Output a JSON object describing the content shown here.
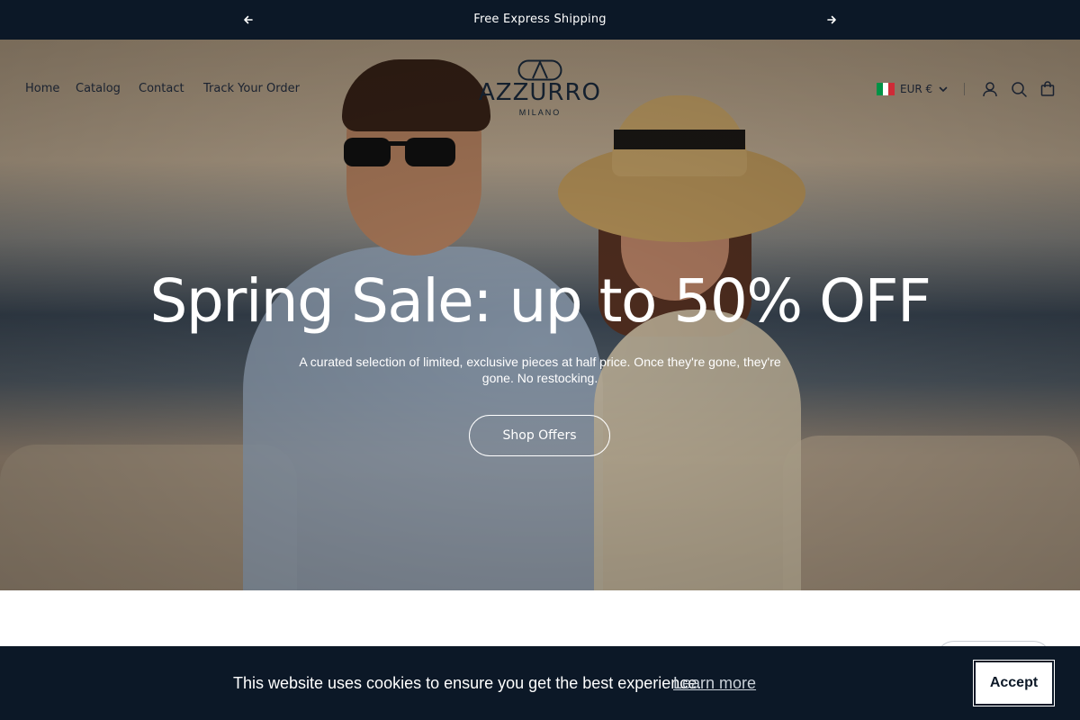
{
  "announcement": {
    "text": "Free Express Shipping",
    "prev_icon": "arrow-left-icon",
    "next_icon": "arrow-right-icon"
  },
  "nav": {
    "links": [
      "Home",
      "Catalog",
      "Contact",
      "Track Your Order"
    ]
  },
  "logo": {
    "name": "AZZURRO",
    "subtitle": "MILANO"
  },
  "header": {
    "currency": "EUR €",
    "flag_colors": [
      "#009246",
      "#ffffff",
      "#ce2b37"
    ],
    "icons": [
      "account-icon",
      "search-icon",
      "cart-icon"
    ]
  },
  "hero": {
    "title": "Spring Sale: up to 50% OFF",
    "subtitle": "A curated selection of limited, exclusive pieces at half price. Once they're gone, they're gone. No restocking.",
    "cta": "Shop Offers"
  },
  "cookie": {
    "message": "This website uses cookies to ensure you get the best experience.",
    "learn_more": "Learn more",
    "accept": "Accept"
  },
  "colors": {
    "dark_navy": "#0c1827",
    "text_dark": "#1a2230"
  }
}
